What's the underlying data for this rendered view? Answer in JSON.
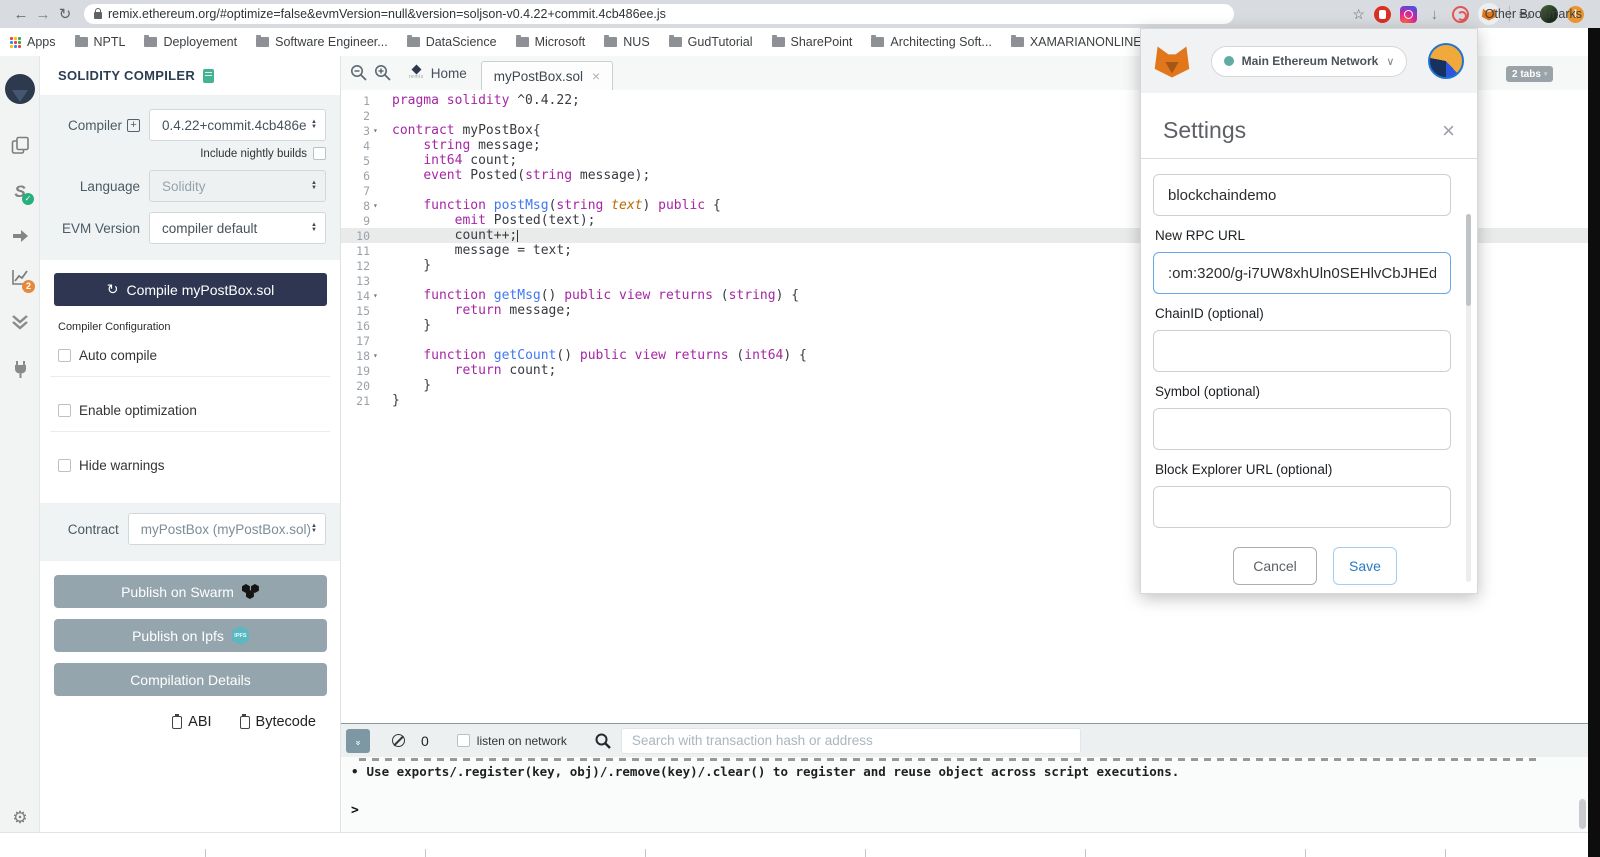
{
  "browser": {
    "back_icon": "←",
    "forward_icon": "→",
    "reload_icon": "↻",
    "url": "remix.ethereum.org/#optimize=false&evmVersion=null&version=soljson-v0.4.22+commit.4cb486ee.js",
    "star_icon": "☆",
    "apps_label": "Apps",
    "bookmarks": [
      "NPTL",
      "Deployement",
      "Software Engineer...",
      "DataScience",
      "Microsoft",
      "NUS",
      "GudTutorial",
      "SharePoint",
      "Architecting Soft...",
      "XAMARIANONLINE"
    ],
    "other_bookmarks": "Other Bookmarks",
    "extension_icons": [
      "adblock-icon",
      "instagram-icon",
      "download-icon",
      "swirl-icon",
      "metamask-icon",
      "playlist-icon",
      "profile-avatar",
      "alert-badge"
    ]
  },
  "page_badge": "2 tabs",
  "rail_icons": [
    "remix-logo",
    "file-explorer-icon",
    "solidity-compiler-icon",
    "deploy-run-icon",
    "analysis-icon",
    "debugger-icon",
    "plugin-manager-icon",
    "settings-gear-icon"
  ],
  "rail": {
    "analysis_badge": "2",
    "solidity_check": "✓",
    "gear_glyph": "⚙"
  },
  "panel": {
    "title": "SOLIDITY COMPILER",
    "compiler_label": "Compiler",
    "compiler_value": "0.4.22+commit.4cb486e",
    "nightly_label": "Include nightly builds",
    "language_label": "Language",
    "language_value": "Solidity",
    "evm_label": "EVM Version",
    "evm_value": "compiler default",
    "compile_icon": "↻",
    "compile_button": "Compile myPostBox.sol",
    "config_label": "Compiler Configuration",
    "auto_compile": "Auto compile",
    "enable_optimization": "Enable optimization",
    "hide_warnings": "Hide warnings",
    "contract_label": "Contract",
    "contract_value": "myPostBox (myPostBox.sol)",
    "publish_swarm": "Publish on Swarm",
    "publish_ipfs": "Publish on Ipfs",
    "ipfs_icon_text": "IPFS",
    "compilation_details": "Compilation Details",
    "abi": "ABI",
    "bytecode": "Bytecode"
  },
  "editor": {
    "home_tab": "Home",
    "home_logo_text": "remix",
    "file_tab": "myPostBox.sol",
    "close_icon": "×",
    "fold_icon": "▾",
    "lines": [
      {
        "n": 1,
        "seg": [
          [
            "k",
            "pragma solidity "
          ],
          [
            "p",
            "^0.4.22;"
          ]
        ]
      },
      {
        "n": 2,
        "seg": []
      },
      {
        "n": 3,
        "fold": true,
        "seg": [
          [
            "k",
            "contract "
          ],
          [
            "p",
            "myPostBox{"
          ]
        ]
      },
      {
        "n": 4,
        "seg": [
          [
            "p",
            "    "
          ],
          [
            "k",
            "string"
          ],
          [
            "p",
            " message;"
          ]
        ]
      },
      {
        "n": 5,
        "seg": [
          [
            "p",
            "    "
          ],
          [
            "k",
            "int64"
          ],
          [
            "p",
            " count;"
          ]
        ]
      },
      {
        "n": 6,
        "seg": [
          [
            "p",
            "    "
          ],
          [
            "k",
            "event"
          ],
          [
            "p",
            " Posted("
          ],
          [
            "k",
            "string"
          ],
          [
            "p",
            " message);"
          ]
        ]
      },
      {
        "n": 7,
        "seg": []
      },
      {
        "n": 8,
        "fold": true,
        "seg": [
          [
            "p",
            "    "
          ],
          [
            "k",
            "function "
          ],
          [
            "f",
            "postMsg"
          ],
          [
            "p",
            "("
          ],
          [
            "k",
            "string"
          ],
          [
            "o",
            " text"
          ],
          [
            "p",
            ") "
          ],
          [
            "k",
            "public"
          ],
          [
            "p",
            " {"
          ]
        ]
      },
      {
        "n": 9,
        "seg": [
          [
            "p",
            "        "
          ],
          [
            "k",
            "emit"
          ],
          [
            "p",
            " Posted(text);"
          ]
        ]
      },
      {
        "n": 10,
        "active": true,
        "cursor": true,
        "seg": [
          [
            "p",
            "        count++;"
          ]
        ]
      },
      {
        "n": 11,
        "seg": [
          [
            "p",
            "        message = text;"
          ]
        ]
      },
      {
        "n": 12,
        "seg": [
          [
            "p",
            "    }"
          ]
        ]
      },
      {
        "n": 13,
        "seg": []
      },
      {
        "n": 14,
        "fold": true,
        "seg": [
          [
            "p",
            "    "
          ],
          [
            "k",
            "function "
          ],
          [
            "f",
            "getMsg"
          ],
          [
            "p",
            "() "
          ],
          [
            "k",
            "public view returns"
          ],
          [
            "p",
            " ("
          ],
          [
            "k",
            "string"
          ],
          [
            "p",
            ") {"
          ]
        ]
      },
      {
        "n": 15,
        "seg": [
          [
            "p",
            "        "
          ],
          [
            "k",
            "return"
          ],
          [
            "p",
            " message;"
          ]
        ]
      },
      {
        "n": 16,
        "seg": [
          [
            "p",
            "    }"
          ]
        ]
      },
      {
        "n": 17,
        "seg": []
      },
      {
        "n": 18,
        "fold": true,
        "seg": [
          [
            "p",
            "    "
          ],
          [
            "k",
            "function "
          ],
          [
            "f",
            "getCount"
          ],
          [
            "p",
            "() "
          ],
          [
            "k",
            "public view returns"
          ],
          [
            "p",
            " ("
          ],
          [
            "k",
            "int64"
          ],
          [
            "p",
            ") {"
          ]
        ]
      },
      {
        "n": 19,
        "seg": [
          [
            "p",
            "        "
          ],
          [
            "k",
            "return"
          ],
          [
            "p",
            " count;"
          ]
        ]
      },
      {
        "n": 20,
        "seg": [
          [
            "p",
            "    }"
          ]
        ]
      },
      {
        "n": 21,
        "seg": [
          [
            "p",
            "}"
          ]
        ]
      }
    ]
  },
  "terminal": {
    "clear_count": "0",
    "listen_label": "listen on network",
    "search_placeholder": "Search with transaction hash or address",
    "log_bullet": "•",
    "log_line": "Use exports/.register(key, obj)/.remove(key)/.clear() to register and reuse object across script executions.",
    "prompt": ">"
  },
  "metamask": {
    "network": "Main Ethereum Network",
    "network_chevron": "∨",
    "title": "Settings",
    "close_icon": "×",
    "fields": [
      {
        "label": "",
        "value": "blockchaindemo"
      },
      {
        "label": "New RPC URL",
        "value": ":om:3200/g-i7UW8xhUln0SEHlvCbJHEd"
      },
      {
        "label": "ChainID (optional)",
        "value": ""
      },
      {
        "label": "Symbol (optional)",
        "value": ""
      },
      {
        "label": "Block Explorer URL (optional)",
        "value": ""
      }
    ],
    "cancel": "Cancel",
    "save": "Save"
  },
  "colors": {
    "compile_button_navy": "#2f3652",
    "publish_gray": "#95a5ae",
    "keyword_purple": "#a626a4",
    "function_blue": "#4078f2",
    "param_orange": "#b76b01",
    "network_dot_teal": "#60aba2",
    "save_blue": "#2779c6",
    "metamask_orange": "#e2761b",
    "analysis_badge_orange": "#e8883a",
    "check_green": "#27b07c"
  }
}
